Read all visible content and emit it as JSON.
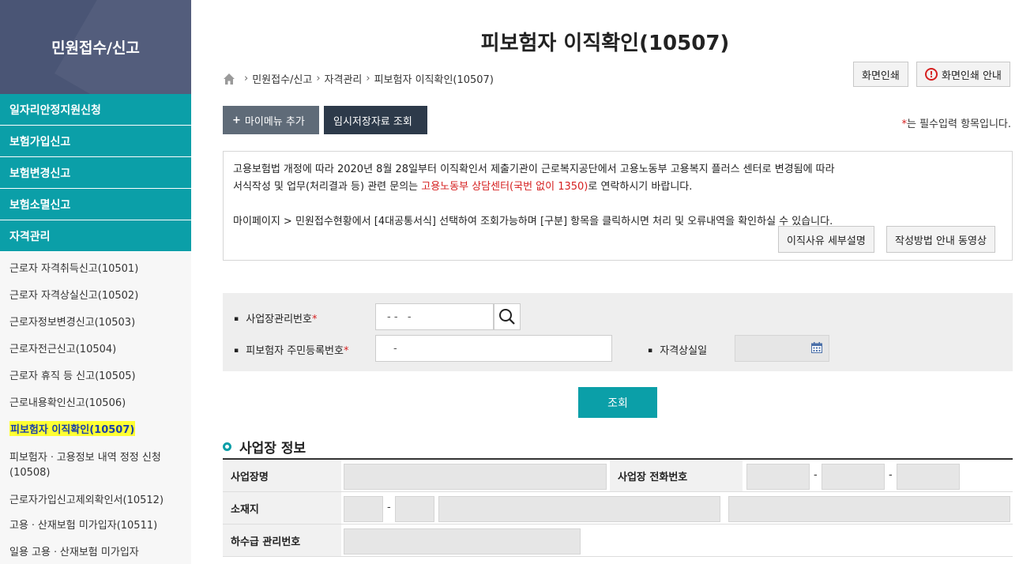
{
  "sidebar": {
    "title": "민원접수/신고",
    "main_items": [
      "일자리안정지원신청",
      "보험가입신고",
      "보험변경신고",
      "보험소멸신고",
      "자격관리"
    ],
    "sub_items": [
      "근로자 자격취득신고(10501)",
      "근로자 자격상실신고(10502)",
      "근로자정보변경신고(10503)",
      "근로자전근신고(10504)",
      "근로자 휴직 등 신고(10505)",
      "근로내용확인신고(10506)",
      "피보험자 이직확인(10507)",
      "피보험자ㆍ고용정보 내역 정정 신청",
      "(10508)",
      "근로자가입신고제외확인서(10512)",
      "고용ㆍ산재보험 미가입자(10511)",
      "일용 고용ㆍ산재보험 미가입자"
    ]
  },
  "page": {
    "title": "피보험자 이직확인(10507)",
    "breadcrumb": [
      "민원접수/신고",
      "자격관리",
      "피보험자 이직확인(10507)"
    ],
    "print_label": "화면인쇄",
    "print_guide_label": "화면인쇄 안내",
    "add_menu_label": "마이메뉴 추가",
    "temp_saved_label": "임시저장자료 조회",
    "required_note": "는 필수입력 항목입니다."
  },
  "notice": {
    "line1": "고용보험법 개정에 따라 2020년 8월 28일부터 이직확인서 제출기관이 근로복지공단에서 고용노동부 고용복지 플러스 센터로 변경됨에 따라",
    "line2_pre": "서식작성 및 업무(처리결과 등) 관련 문의는 ",
    "line2_red": "고용노동부 상담센터(국번 없이 1350)",
    "line2_post": "로 연락하시기 바랍니다.",
    "line3": "마이페이지 > 민원접수현황에서 [4대공통서식] 선택하여 조회가능하며 [구분] 항목을 클릭하시면 처리 및 오류내역을 확인하실 수 있습니다.",
    "btn_reason": "이직사유 세부설명",
    "btn_video": "작성방법 안내 동영상"
  },
  "search": {
    "biz_no_label": "사업장관리번호",
    "biz_no_value": "- -   -",
    "ssn_label": "피보험자 주민등록번호",
    "ssn_value": "-",
    "loss_date_label": "자격상실일",
    "query_label": "조회"
  },
  "workplace": {
    "section_title": "사업장 정보",
    "name_label": "사업장명",
    "phone_label": "사업장 전화번호",
    "address_label": "소재지",
    "subcontract_label": "하수급 관리번호"
  },
  "colors": {
    "teal": "#0b9fa8",
    "navy": "#4a5575",
    "dark_btn": "#2d3a4a",
    "gray_btn": "#5f6b78"
  }
}
